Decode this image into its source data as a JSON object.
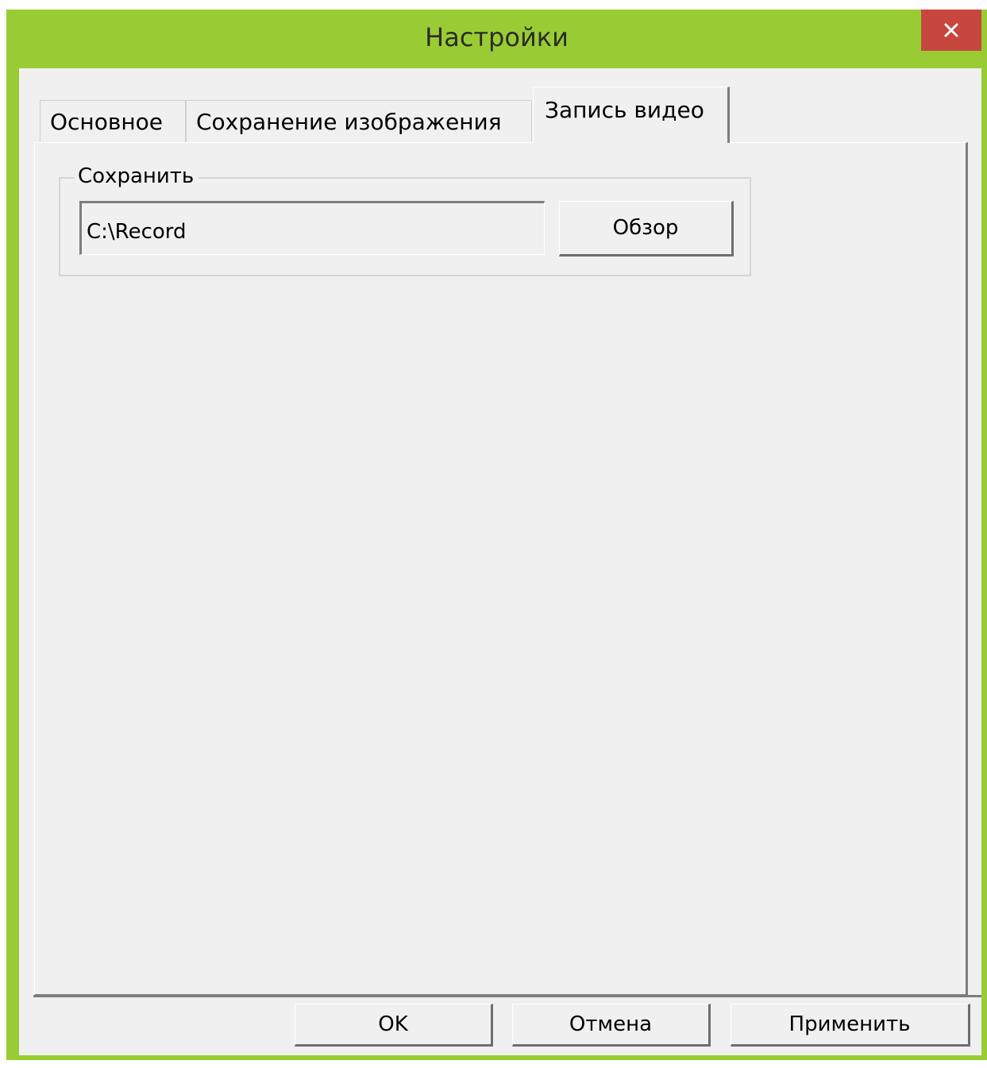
{
  "window": {
    "title": "Настройки",
    "close_icon": "close-icon",
    "frame_color": "#99cc33",
    "close_color": "#c7473f"
  },
  "tabs": [
    {
      "label": "Основное",
      "selected": false
    },
    {
      "label": "Сохранение изображения",
      "selected": false
    },
    {
      "label": "Запись видео",
      "selected": true
    }
  ],
  "save_group": {
    "label": "Сохранить",
    "path_value": "C:\\Record",
    "browse_label": "Обзор"
  },
  "footer": {
    "ok_label": "OK",
    "cancel_label": "Отмена",
    "apply_label": "Применить"
  }
}
